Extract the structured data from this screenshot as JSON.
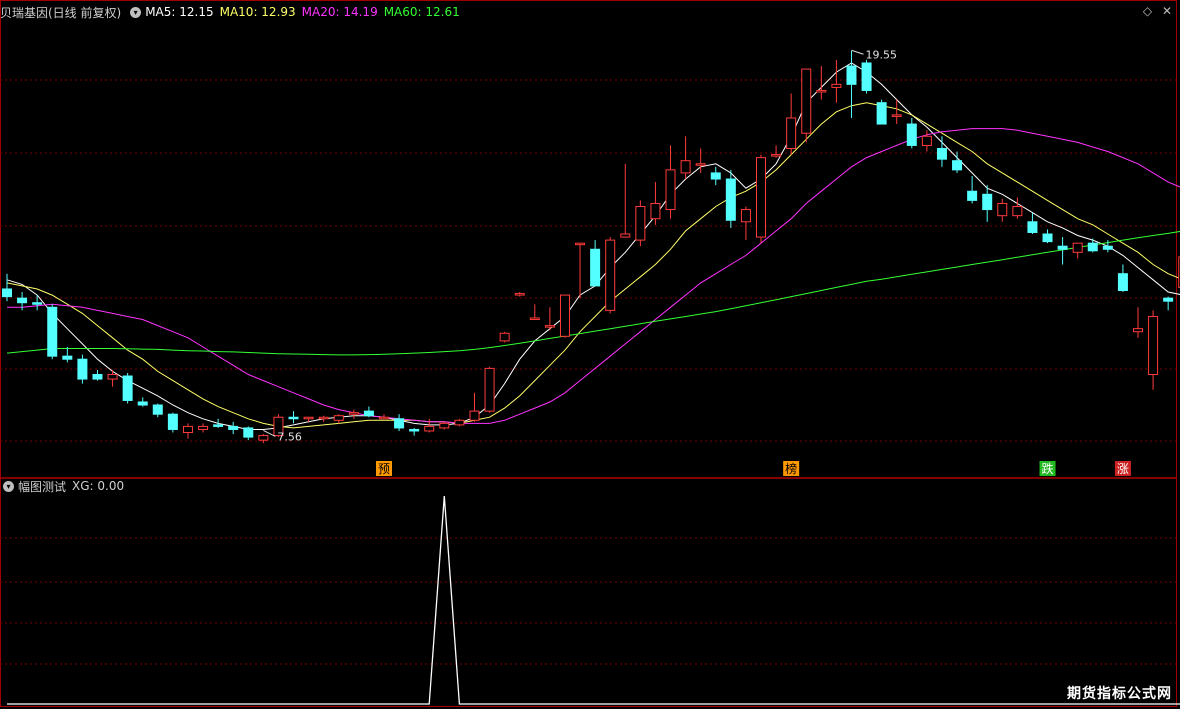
{
  "main_header": {
    "title": "贝瑞基因(日线 前复权)",
    "ma5": "MA5: 12.15",
    "ma10": "MA10: 12.93",
    "ma20": "MA20: 14.19",
    "ma60": "MA60: 12.61"
  },
  "sub_header": {
    "title": "幅图测试",
    "xg": "XG: 0.00"
  },
  "corner_icons": [
    "diamond-icon",
    "close-icon"
  ],
  "watermark": "期货指标公式网",
  "colors": {
    "up": "#ff3b3b",
    "down": "#54ffff",
    "ma5": "#ffffff",
    "ma10": "#ffff66",
    "ma20": "#ff33ff",
    "ma60": "#33ff33",
    "grid": "#7a0000",
    "sub_line": "#ffffff"
  },
  "chart_data": [
    {
      "type": "candlestick",
      "title": "贝瑞基因(日线 前复权)",
      "ylim": [
        6.2,
        21.0
      ],
      "candles": [
        [
          11.8,
          12.3,
          11.4,
          11.55
        ],
        [
          11.5,
          11.7,
          11.1,
          11.35
        ],
        [
          11.35,
          11.6,
          11.1,
          11.3
        ],
        [
          11.2,
          11.3,
          9.5,
          9.6
        ],
        [
          9.6,
          9.9,
          9.4,
          9.5
        ],
        [
          9.5,
          9.65,
          8.7,
          8.85
        ],
        [
          9.0,
          9.15,
          8.8,
          8.85
        ],
        [
          8.85,
          9.15,
          8.6,
          9.0
        ],
        [
          8.95,
          9.05,
          8.05,
          8.15
        ],
        [
          8.1,
          8.25,
          7.95,
          8.0
        ],
        [
          8.0,
          8.05,
          7.6,
          7.7
        ],
        [
          7.7,
          7.75,
          7.1,
          7.2
        ],
        [
          7.1,
          7.4,
          6.9,
          7.3
        ],
        [
          7.2,
          7.4,
          7.1,
          7.3
        ],
        [
          7.35,
          7.55,
          7.25,
          7.3
        ],
        [
          7.3,
          7.45,
          7.05,
          7.2
        ],
        [
          7.25,
          7.3,
          6.85,
          6.95
        ],
        [
          6.85,
          7.05,
          6.75,
          7.0
        ],
        [
          7.0,
          7.7,
          6.95,
          7.6
        ],
        [
          7.6,
          7.8,
          7.4,
          7.55
        ],
        [
          7.55,
          7.6,
          7.45,
          7.6
        ],
        [
          7.55,
          7.65,
          7.45,
          7.6
        ],
        [
          7.5,
          7.7,
          7.4,
          7.65
        ],
        [
          7.7,
          7.85,
          7.55,
          7.75
        ],
        [
          7.8,
          7.95,
          7.6,
          7.65
        ],
        [
          7.6,
          7.7,
          7.55,
          7.6
        ],
        [
          7.55,
          7.7,
          7.15,
          7.25
        ],
        [
          7.2,
          7.25,
          7.0,
          7.15
        ],
        [
          7.15,
          7.55,
          7.1,
          7.3
        ],
        [
          7.25,
          7.45,
          7.2,
          7.4
        ],
        [
          7.35,
          7.55,
          7.3,
          7.5
        ],
        [
          7.5,
          8.4,
          7.45,
          7.8
        ],
        [
          7.8,
          9.25,
          7.75,
          9.2
        ],
        [
          10.1,
          10.4,
          10.05,
          10.35
        ],
        [
          11.65,
          11.7,
          11.55,
          11.65
        ],
        [
          10.85,
          11.3,
          10.8,
          10.85
        ],
        [
          10.55,
          11.2,
          10.45,
          10.6
        ],
        [
          10.25,
          11.6,
          10.2,
          11.6
        ],
        [
          13.3,
          13.3,
          11.5,
          13.3
        ],
        [
          13.1,
          13.4,
          11.9,
          11.9
        ],
        [
          11.1,
          13.5,
          11.0,
          13.4
        ],
        [
          13.5,
          15.9,
          13.5,
          13.6
        ],
        [
          13.4,
          14.7,
          13.2,
          14.5
        ],
        [
          14.1,
          15.3,
          13.9,
          14.6
        ],
        [
          14.4,
          16.5,
          14.1,
          15.7
        ],
        [
          15.6,
          16.8,
          15.4,
          16.0
        ],
        [
          15.9,
          16.4,
          15.6,
          15.9
        ],
        [
          15.6,
          15.8,
          15.2,
          15.4
        ],
        [
          15.4,
          15.7,
          13.8,
          14.05
        ],
        [
          14.0,
          14.5,
          13.4,
          14.4
        ],
        [
          13.5,
          16.2,
          13.3,
          16.1
        ],
        [
          16.2,
          16.5,
          16.1,
          16.2
        ],
        [
          16.4,
          18.2,
          16.2,
          17.4
        ],
        [
          16.9,
          19.0,
          16.6,
          19.0
        ],
        [
          18.3,
          19.1,
          18.0,
          18.3
        ],
        [
          18.4,
          19.3,
          17.9,
          18.5
        ],
        [
          19.1,
          19.6,
          17.4,
          18.5
        ],
        [
          19.2,
          19.3,
          18.2,
          18.3
        ],
        [
          17.9,
          18.0,
          17.2,
          17.2
        ],
        [
          17.5,
          18.0,
          17.2,
          17.5
        ],
        [
          17.2,
          17.4,
          16.4,
          16.5
        ],
        [
          16.5,
          17.0,
          16.3,
          16.8
        ],
        [
          16.4,
          16.8,
          15.8,
          16.05
        ],
        [
          16.0,
          16.3,
          15.6,
          15.7
        ],
        [
          15.0,
          15.5,
          14.6,
          14.7
        ],
        [
          14.9,
          15.2,
          14.0,
          14.4
        ],
        [
          14.2,
          14.75,
          14.0,
          14.6
        ],
        [
          14.2,
          14.8,
          14.1,
          14.5
        ],
        [
          14.0,
          14.3,
          13.6,
          13.65
        ],
        [
          13.6,
          13.75,
          13.3,
          13.35
        ],
        [
          13.2,
          13.5,
          12.6,
          13.1
        ],
        [
          13.0,
          13.3,
          12.8,
          13.3
        ],
        [
          13.3,
          13.45,
          13.0,
          13.05
        ],
        [
          13.2,
          13.4,
          13.0,
          13.1
        ],
        [
          12.3,
          12.6,
          11.7,
          11.75
        ],
        [
          10.4,
          11.2,
          10.2,
          10.5
        ],
        [
          9.0,
          11.1,
          8.5,
          10.9
        ],
        [
          11.5,
          11.55,
          11.1,
          11.4
        ],
        [
          11.85,
          13.0,
          11.8,
          12.85
        ]
      ],
      "series": [
        {
          "name": "MA5",
          "color": "#ffffff",
          "values": [
            12.1,
            11.95,
            11.6,
            11.0,
            10.5,
            10.0,
            9.5,
            9.1,
            8.8,
            8.55,
            8.3,
            8.0,
            7.75,
            7.55,
            7.4,
            7.3,
            7.2,
            7.2,
            7.25,
            7.35,
            7.45,
            7.55,
            7.6,
            7.65,
            7.65,
            7.6,
            7.5,
            7.4,
            7.35,
            7.35,
            7.4,
            7.6,
            8.0,
            8.7,
            9.5,
            10.1,
            10.5,
            10.9,
            11.6,
            11.9,
            12.5,
            13.0,
            13.6,
            14.2,
            14.9,
            15.4,
            15.8,
            15.9,
            15.6,
            15.1,
            15.4,
            15.9,
            16.8,
            17.9,
            18.4,
            18.9,
            19.2,
            18.9,
            18.5,
            18.0,
            17.5,
            17.1,
            16.6,
            16.1,
            15.6,
            15.1,
            14.9,
            14.6,
            14.3,
            14.0,
            13.8,
            13.55,
            13.4,
            13.2,
            12.9,
            12.5,
            12.1,
            11.7,
            11.6
          ]
        },
        {
          "name": "MA10",
          "color": "#ffff66",
          "values": [
            12.0,
            11.9,
            11.8,
            11.6,
            11.3,
            11.0,
            10.6,
            10.2,
            9.8,
            9.5,
            9.1,
            8.8,
            8.5,
            8.2,
            7.95,
            7.75,
            7.55,
            7.4,
            7.3,
            7.25,
            7.3,
            7.35,
            7.4,
            7.45,
            7.5,
            7.5,
            7.5,
            7.5,
            7.45,
            7.45,
            7.4,
            7.5,
            7.6,
            7.9,
            8.3,
            8.8,
            9.3,
            9.8,
            10.4,
            10.9,
            11.4,
            11.8,
            12.2,
            12.6,
            13.1,
            13.7,
            14.1,
            14.5,
            14.8,
            15.0,
            15.3,
            15.7,
            16.2,
            16.7,
            17.2,
            17.6,
            17.8,
            17.9,
            17.8,
            17.7,
            17.5,
            17.2,
            16.9,
            16.6,
            16.3,
            15.9,
            15.6,
            15.3,
            15.0,
            14.7,
            14.4,
            14.1,
            13.9,
            13.6,
            13.3,
            13.0,
            12.6,
            12.3,
            12.1
          ]
        },
        {
          "name": "MA20",
          "color": "#ff33ff",
          "values": [
            11.2,
            11.2,
            11.25,
            11.3,
            11.25,
            11.2,
            11.1,
            11.0,
            10.9,
            10.8,
            10.6,
            10.4,
            10.2,
            9.9,
            9.6,
            9.3,
            9.0,
            8.8,
            8.6,
            8.4,
            8.2,
            8.0,
            7.85,
            7.75,
            7.65,
            7.6,
            7.55,
            7.5,
            7.45,
            7.45,
            7.4,
            7.4,
            7.4,
            7.5,
            7.7,
            7.9,
            8.1,
            8.4,
            8.8,
            9.2,
            9.6,
            10.0,
            10.4,
            10.8,
            11.2,
            11.6,
            12.0,
            12.3,
            12.6,
            12.9,
            13.3,
            13.7,
            14.1,
            14.6,
            15.0,
            15.4,
            15.8,
            16.1,
            16.3,
            16.5,
            16.7,
            16.85,
            16.95,
            17.0,
            17.05,
            17.05,
            17.05,
            17.0,
            16.9,
            16.8,
            16.7,
            16.6,
            16.45,
            16.3,
            16.1,
            15.9,
            15.6,
            15.3,
            15.1
          ]
        },
        {
          "name": "MA60",
          "color": "#33ff33",
          "values": [
            9.7,
            9.75,
            9.8,
            9.85,
            9.85,
            9.85,
            9.85,
            9.85,
            9.84,
            9.83,
            9.82,
            9.8,
            9.78,
            9.77,
            9.75,
            9.74,
            9.72,
            9.7,
            9.68,
            9.67,
            9.66,
            9.65,
            9.64,
            9.64,
            9.65,
            9.66,
            9.68,
            9.7,
            9.72,
            9.75,
            9.78,
            9.82,
            9.88,
            9.95,
            10.02,
            10.1,
            10.18,
            10.26,
            10.34,
            10.42,
            10.5,
            10.58,
            10.66,
            10.74,
            10.82,
            10.9,
            10.98,
            11.06,
            11.15,
            11.25,
            11.35,
            11.45,
            11.55,
            11.65,
            11.75,
            11.85,
            11.95,
            12.05,
            12.12,
            12.2,
            12.28,
            12.36,
            12.44,
            12.52,
            12.6,
            12.68,
            12.76,
            12.84,
            12.92,
            13.0,
            13.08,
            13.16,
            13.24,
            13.32,
            13.4,
            13.48,
            13.55,
            13.62,
            13.7
          ]
        }
      ],
      "annotations": [
        {
          "label": "19.55",
          "index": 56,
          "value": 19.55,
          "kind": "high"
        },
        {
          "label": "7.56",
          "index": 17,
          "value": 7.56,
          "kind": "low"
        }
      ],
      "markers": [
        {
          "label": "预",
          "index": 25,
          "color": "#ff9900",
          "text_color": "#000000"
        },
        {
          "label": "榜",
          "index": 52,
          "color": "#ff9900",
          "text_color": "#000000"
        },
        {
          "label": "跌",
          "index": 69,
          "color": "#22bb22",
          "text_color": "#ffffff"
        },
        {
          "label": "涨",
          "index": 74,
          "color": "#cc2222",
          "text_color": "#ffffff"
        }
      ]
    },
    {
      "type": "line",
      "title": "幅图测试",
      "series": [
        {
          "name": "XG",
          "color": "#ffffff",
          "values": [
            0,
            0,
            0,
            0,
            0,
            0,
            0,
            0,
            0,
            0,
            0,
            0,
            0,
            0,
            0,
            0,
            0,
            0,
            0,
            0,
            0,
            0,
            0,
            0,
            0,
            0,
            0,
            0,
            0,
            1,
            0,
            0,
            0,
            0,
            0,
            0,
            0,
            0,
            0,
            0,
            0,
            0,
            0,
            0,
            0,
            0,
            0,
            0,
            0,
            0,
            0,
            0,
            0,
            0,
            0,
            0,
            0,
            0,
            0,
            0,
            0,
            0,
            0,
            0,
            0,
            0,
            0,
            0,
            0,
            0,
            0,
            0,
            0,
            0,
            0,
            0,
            0,
            0,
            0
          ]
        }
      ],
      "ylim": [
        0,
        1
      ]
    }
  ]
}
